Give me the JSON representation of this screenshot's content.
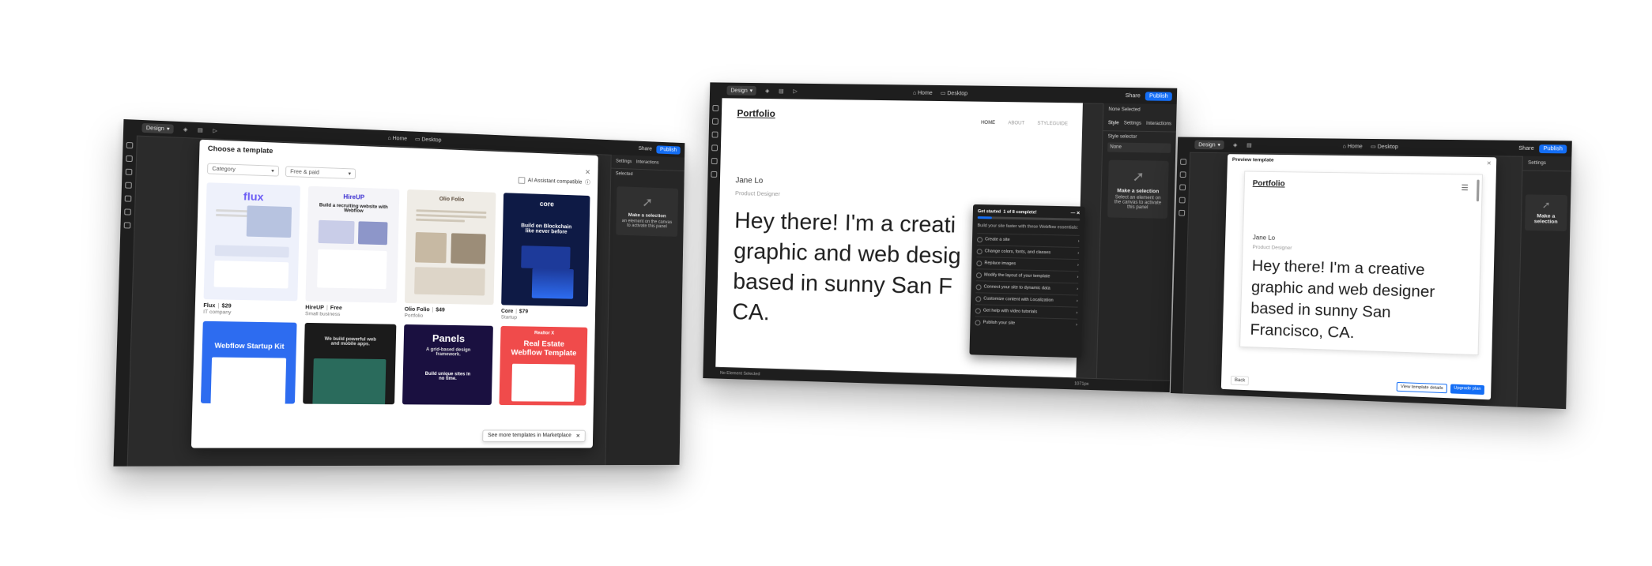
{
  "editor": {
    "design_label": "Design",
    "page_label": "Home",
    "breakpoint_label": "Desktop",
    "share_label": "Share",
    "publish_label": "Publish",
    "settings_tab": "Settings",
    "interactions_tab": "Interactions",
    "style_tab": "Style",
    "none_selected": "None Selected",
    "style_selector": "Style selector",
    "none_value": "None",
    "selected_label": "Selected",
    "make_selection_title": "Make a selection",
    "make_selection_desc": "Select an element on the canvas to activate this panel",
    "make_selection_desc_clipped": "an element on the canvas to activate this panel",
    "no_element_selected": "No Element Selected",
    "zoom": "1071px"
  },
  "template_modal": {
    "title": "Choose a template",
    "category_placeholder": "Category",
    "price_filter": "Free & paid",
    "ai_compatible": "AI Assistant compatible",
    "marketplace_link": "See more templates in Marketplace",
    "templates": [
      {
        "name": "Flux",
        "price": "$29",
        "category": "IT company",
        "logo": "flux",
        "colors": [
          "#eef1fb",
          "#6b5cf5"
        ]
      },
      {
        "name": "HireUP",
        "price": "Free",
        "category": "Small business",
        "logo": "HireUP",
        "headline": "Build a recruiting website with Webflow",
        "colors": [
          "#f4f4f8",
          "#3b2fd1"
        ]
      },
      {
        "name": "Olio Folio",
        "price": "$49",
        "category": "Portfolio",
        "logo": "Olio Folio",
        "colors": [
          "#efece6",
          "#5a4a3a"
        ]
      },
      {
        "name": "Core",
        "price": "$79",
        "category": "Startup",
        "logo": "core",
        "headline": "Build on Blockchain like never before",
        "colors": [
          "#0e1a45",
          "#2d6cf0"
        ]
      }
    ],
    "templates_row2": [
      {
        "label": "Webflow Startup Kit",
        "colors": [
          "#2d6cf0",
          "#ffffff"
        ]
      },
      {
        "label": "We build powerful web and mobile apps.",
        "colors": [
          "#1b1b1b",
          "#2a6b5c"
        ]
      },
      {
        "label": "Panels",
        "sub": "A grid-based design framework.",
        "sub2": "Build unique sites in no time.",
        "colors": [
          "#1a1040",
          "#9b5cf5"
        ]
      },
      {
        "label": "Real Estate Webflow Template",
        "badge": "Realtor X",
        "colors": [
          "#f04b4b",
          "#ffffff"
        ]
      }
    ]
  },
  "portfolio": {
    "logo": "Portfolio",
    "nav": [
      "HOME",
      "ABOUT",
      "STYLEGUIDE"
    ],
    "name": "Jane Lo",
    "role": "Product Designer",
    "hero_lines": [
      "Hey there! I'm a creati",
      "graphic and web desig",
      "based in sunny San F",
      "CA."
    ],
    "hero_preview_lines": [
      "Hey there! I'm a creative",
      "graphic and web designer",
      "based in sunny San",
      "Francisco, CA."
    ]
  },
  "get_started": {
    "title": "Get started",
    "progress_text": "1 of 8 complete!",
    "progress": 0.14,
    "subtitle": "Build your site faster with these Webflow essentials:",
    "items": [
      "Create a site",
      "Change colors, fonts, and classes",
      "Replace images",
      "Modify the layout of your template",
      "Connect your site to dynamic data",
      "Customize content with Localization",
      "Get help with video tutorials",
      "Publish your site"
    ]
  },
  "preview_modal": {
    "title": "Preview template",
    "back_label": "Back",
    "view_details_label": "View template details",
    "upgrade_label": "Upgrade plan"
  },
  "colors": {
    "accent": "#146ef5",
    "chrome": "#1e1e1e",
    "panel": "#262626"
  }
}
